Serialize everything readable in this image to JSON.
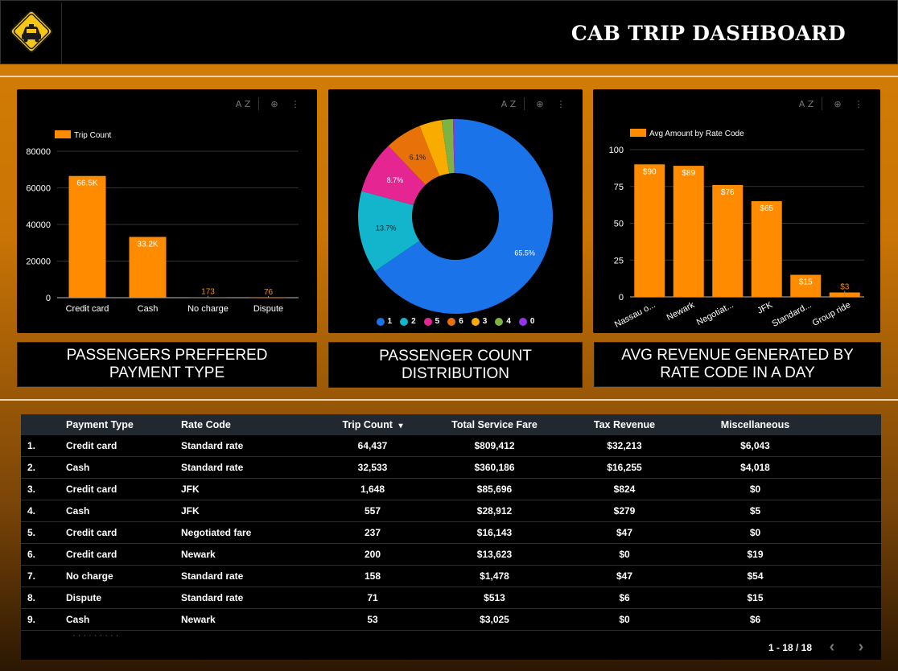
{
  "header": {
    "title": "CAB TRIP DASHBOARD",
    "logo_icon": "taxi-sign-icon"
  },
  "colors": {
    "accent": "#ff8c00",
    "background_top": "#d47f05",
    "panel": "#000000"
  },
  "chart_tools": {
    "sort_label": "A Z",
    "zoom_icon": "zoom-icon",
    "more_icon": "more-vert-icon"
  },
  "captions": {
    "payment": "PASSENGERS PREFFERED PAYMENT TYPE",
    "passenger": "PASSENGER COUNT DISTRIBUTION",
    "revenue": "AVG REVENUE GENERATED BY RATE CODE IN A DAY"
  },
  "chart_data": [
    {
      "type": "bar",
      "legend": "Trip Count",
      "legend_position": "top-left",
      "categories": [
        "Credit card",
        "Cash",
        "No charge",
        "Dispute"
      ],
      "values": [
        66500,
        33200,
        173,
        76
      ],
      "data_labels": [
        "66.5K",
        "33.2K",
        "173",
        "76"
      ],
      "yticks": [
        "80000",
        "60000",
        "40000",
        "20000",
        "0"
      ],
      "ylim": [
        0,
        80000
      ],
      "grid": true,
      "color": "#ff8c00"
    },
    {
      "type": "pie",
      "donut": true,
      "legend_position": "bottom",
      "slices": [
        {
          "label": "1",
          "value": 65.5,
          "text": "65.5%",
          "color": "#1a73e8"
        },
        {
          "label": "2",
          "value": 13.7,
          "text": "13.7%",
          "color": "#12b5cb"
        },
        {
          "label": "5",
          "value": 8.7,
          "text": "8.7%",
          "color": "#e52592"
        },
        {
          "label": "6",
          "value": 6.1,
          "text": "6.1%",
          "color": "#e8710a"
        },
        {
          "label": "3",
          "value": 3.7,
          "text": "",
          "color": "#f9ab00"
        },
        {
          "label": "4",
          "value": 1.9,
          "text": "",
          "color": "#7cb342"
        },
        {
          "label": "0",
          "value": 0.4,
          "text": "",
          "color": "#9334e6"
        }
      ]
    },
    {
      "type": "bar",
      "legend": "Avg Amount by Rate Code",
      "legend_position": "top-left",
      "categories": [
        "Nassau o...",
        "Newark",
        "Negotiat...",
        "JFK",
        "Standard...",
        "Group ride"
      ],
      "values": [
        90,
        89,
        76,
        65,
        15,
        3
      ],
      "data_labels": [
        "$90",
        "$89",
        "$76",
        "$65",
        "$15",
        "$3"
      ],
      "yticks": [
        "100",
        "75",
        "50",
        "25",
        "0"
      ],
      "ylim": [
        0,
        100
      ],
      "grid": true,
      "color": "#ff8c00"
    }
  ],
  "table": {
    "columns": [
      "Payment Type",
      "Rate Code",
      "Trip Count",
      "Total Service Fare",
      "Tax Revenue",
      "Miscellaneous"
    ],
    "sort_indicator": "▾",
    "rows": [
      {
        "idx": "1.",
        "pay": "Credit card",
        "rate": "Standard rate",
        "trip": "64,437",
        "fare": "$809,412",
        "tax": "$32,213",
        "misc": "$6,043"
      },
      {
        "idx": "2.",
        "pay": "Cash",
        "rate": "Standard rate",
        "trip": "32,533",
        "fare": "$360,186",
        "tax": "$16,255",
        "misc": "$4,018"
      },
      {
        "idx": "3.",
        "pay": "Credit card",
        "rate": "JFK",
        "trip": "1,648",
        "fare": "$85,696",
        "tax": "$824",
        "misc": "$0"
      },
      {
        "idx": "4.",
        "pay": "Cash",
        "rate": "JFK",
        "trip": "557",
        "fare": "$28,912",
        "tax": "$279",
        "misc": "$5"
      },
      {
        "idx": "5.",
        "pay": "Credit card",
        "rate": "Negotiated fare",
        "trip": "237",
        "fare": "$16,143",
        "tax": "$47",
        "misc": "$0"
      },
      {
        "idx": "6.",
        "pay": "Credit card",
        "rate": "Newark",
        "trip": "200",
        "fare": "$13,623",
        "tax": "$0",
        "misc": "$19"
      },
      {
        "idx": "7.",
        "pay": "No charge",
        "rate": "Standard rate",
        "trip": "158",
        "fare": "$1,478",
        "tax": "$47",
        "misc": "$54"
      },
      {
        "idx": "8.",
        "pay": "Dispute",
        "rate": "Standard rate",
        "trip": "71",
        "fare": "$513",
        "tax": "$6",
        "misc": "$15"
      },
      {
        "idx": "9.",
        "pay": "Cash",
        "rate": "Newark",
        "trip": "53",
        "fare": "$3,025",
        "tax": "$0",
        "misc": "$6"
      }
    ],
    "pagination": "1 - 18 / 18",
    "prev_icon": "chevron-left-icon",
    "next_icon": "chevron-right-icon"
  }
}
